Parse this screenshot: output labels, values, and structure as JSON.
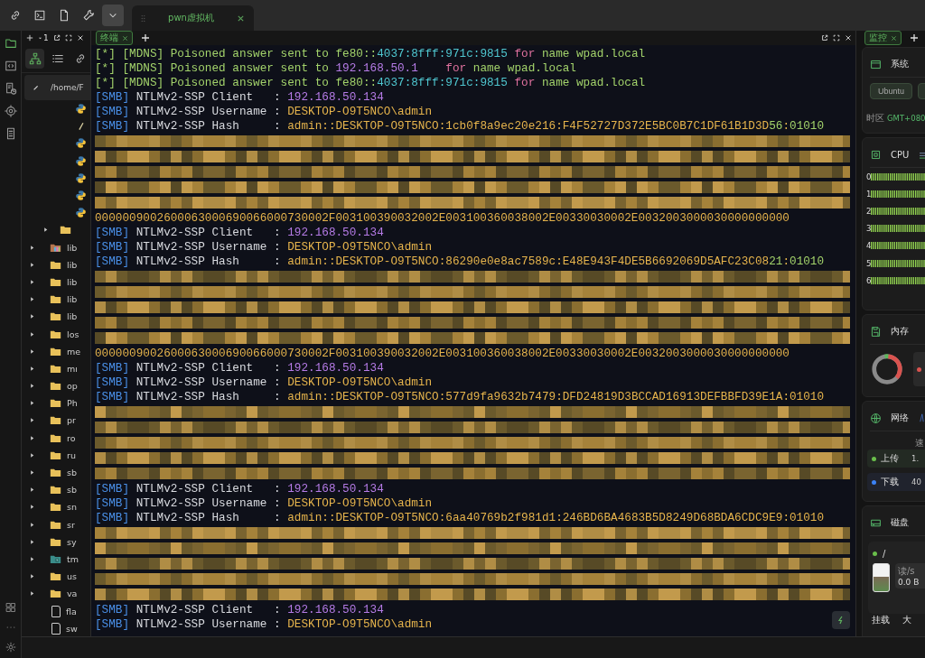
{
  "top_bar": {
    "tools": [
      {
        "kind": "link",
        "selected": false
      },
      {
        "kind": "terminal",
        "selected": false
      },
      {
        "kind": "document",
        "selected": false
      },
      {
        "kind": "wrench",
        "selected": false
      },
      {
        "kind": "chevron",
        "selected": true
      }
    ],
    "tabs": [
      {
        "title": "pwn虚拟机",
        "selected": true
      }
    ]
  },
  "activity_bar": {
    "items": [
      {
        "kind": "folder",
        "selected": true
      },
      {
        "kind": "code",
        "selected": false
      },
      {
        "kind": "database",
        "selected": false
      },
      {
        "kind": "target",
        "selected": false
      },
      {
        "kind": "list",
        "selected": false
      }
    ],
    "bottom": [
      {
        "kind": "grid"
      },
      {
        "kind": "more"
      },
      {
        "kind": "gear"
      }
    ]
  },
  "file_panel": {
    "count": "1",
    "views": [
      {
        "kind": "tree",
        "selected": true
      },
      {
        "kind": "list",
        "selected": false
      },
      {
        "kind": "link",
        "selected": false
      }
    ],
    "path": "/home/F",
    "nested_files": [
      {
        "kind": "python"
      },
      {
        "kind": "pen"
      },
      {
        "kind": "python"
      },
      {
        "kind": "python"
      },
      {
        "kind": "python"
      },
      {
        "kind": "python"
      },
      {
        "kind": "python"
      }
    ],
    "nested_folders": [
      {
        "kind": "folder"
      }
    ],
    "entries": [
      {
        "name": "lib",
        "kind": "colorful"
      },
      {
        "name": "lib",
        "kind": "folder"
      },
      {
        "name": "lib",
        "kind": "folder"
      },
      {
        "name": "lib",
        "kind": "folder"
      },
      {
        "name": "lib",
        "kind": "folder"
      },
      {
        "name": "los",
        "kind": "folder"
      },
      {
        "name": "me",
        "kind": "folder"
      },
      {
        "name": "mı",
        "kind": "folder"
      },
      {
        "name": "op",
        "kind": "folder"
      },
      {
        "name": "Ph",
        "kind": "folder"
      },
      {
        "name": "pr",
        "kind": "folder"
      },
      {
        "name": "ro",
        "kind": "folder"
      },
      {
        "name": "ru",
        "kind": "folder"
      },
      {
        "name": "sb",
        "kind": "folder"
      },
      {
        "name": "sb",
        "kind": "folder"
      },
      {
        "name": "sn",
        "kind": "folder"
      },
      {
        "name": "sr",
        "kind": "folder"
      },
      {
        "name": "sy",
        "kind": "folder"
      },
      {
        "name": "tm",
        "kind": "clock"
      },
      {
        "name": "us",
        "kind": "folder"
      },
      {
        "name": "va",
        "kind": "folder"
      },
      {
        "name": "fla",
        "kind": "file"
      },
      {
        "name": "sw",
        "kind": "file"
      }
    ]
  },
  "terminal": {
    "tabs": [
      {
        "title": "终端",
        "selected": true
      }
    ],
    "blocks": [
      {
        "kind": "line",
        "segments": [
          {
            "text": "[*] [MDNS] Poisoned answer sent to fe80::",
            "color": "#a3d36b"
          },
          {
            "text": "4037:8fff:971c:9815",
            "color": "#4fc6cf"
          },
          {
            "text": " for",
            "color": "#e0719f"
          },
          {
            "text": " name wpad.local",
            "color": "#a3d36b"
          }
        ]
      },
      {
        "kind": "line",
        "segments": [
          {
            "text": "[*] [MDNS] Poisoned answer sent to ",
            "color": "#a3d36b"
          },
          {
            "text": "192.168.50.1",
            "color": "#b57be6"
          },
          {
            "text": "    for",
            "color": "#e0719f"
          },
          {
            "text": " name wpad.local",
            "color": "#a3d36b"
          }
        ]
      },
      {
        "kind": "line",
        "segments": [
          {
            "text": "[*] [MDNS] Poisoned answer sent to fe80::",
            "color": "#a3d36b"
          },
          {
            "text": "4037:8fff:971c:9815",
            "color": "#4fc6cf"
          },
          {
            "text": " for",
            "color": "#e0719f"
          },
          {
            "text": " name wpad.local",
            "color": "#a3d36b"
          }
        ]
      },
      {
        "kind": "line",
        "segments": [
          {
            "text": "[SMB]",
            "color": "#4a90e8"
          },
          {
            "text": " NTLMv2-SSP Client   : ",
            "color": "#d9dbe0"
          },
          {
            "text": "192.168.50.134",
            "color": "#b57be6"
          }
        ]
      },
      {
        "kind": "line",
        "segments": [
          {
            "text": "[SMB]",
            "color": "#4a90e8"
          },
          {
            "text": " NTLMv2-SSP Username : ",
            "color": "#d9dbe0"
          },
          {
            "text": "DESKTOP-O9T5NCO\\admin",
            "color": "#e6b44c"
          }
        ]
      },
      {
        "kind": "line",
        "segments": [
          {
            "text": "[SMB]",
            "color": "#4a90e8"
          },
          {
            "text": " NTLMv2-SSP Hash     : ",
            "color": "#d9dbe0"
          },
          {
            "text": "admin::DESKTOP-O9T5NCO:1cb0f8a9ec20e216:F4F52727D372E5BC0B7C1DF61B1D3D",
            "color": "#e6b44c"
          },
          {
            "text": "56",
            "color": "#a3d36b"
          },
          {
            "text": ":",
            "color": "#e6b44c"
          },
          {
            "text": "01010",
            "color": "#a3d36b"
          }
        ]
      },
      {
        "kind": "redacted"
      },
      {
        "kind": "line",
        "segments": [
          {
            "text": "0000009002600063000690066000730002F003100390032002E003100360038002E00330030002E0032003000030000000000",
            "color": "#e6b44c"
          }
        ]
      },
      {
        "kind": "line",
        "segments": [
          {
            "text": "[SMB]",
            "color": "#4a90e8"
          },
          {
            "text": " NTLMv2-SSP Client   : ",
            "color": "#d9dbe0"
          },
          {
            "text": "192.168.50.134",
            "color": "#b57be6"
          }
        ]
      },
      {
        "kind": "line",
        "segments": [
          {
            "text": "[SMB]",
            "color": "#4a90e8"
          },
          {
            "text": " NTLMv2-SSP Username : ",
            "color": "#d9dbe0"
          },
          {
            "text": "DESKTOP-O9T5NCO\\admin",
            "color": "#e6b44c"
          }
        ]
      },
      {
        "kind": "line",
        "segments": [
          {
            "text": "[SMB]",
            "color": "#4a90e8"
          },
          {
            "text": " NTLMv2-SSP Hash     : ",
            "color": "#d9dbe0"
          },
          {
            "text": "admin::DESKTOP-O9T5NCO:86290e0e8ac7589c:E48E943F4DE5B6692069D5AFC23C08",
            "color": "#e6b44c"
          },
          {
            "text": "21",
            "color": "#a3d36b"
          },
          {
            "text": ":",
            "color": "#e6b44c"
          },
          {
            "text": "01010",
            "color": "#a3d36b"
          }
        ]
      },
      {
        "kind": "redacted"
      },
      {
        "kind": "line",
        "segments": [
          {
            "text": "0000009002600063000690066000730002F003100390032002E003100360038002E00330030002E0032003000030000000000",
            "color": "#e6b44c"
          }
        ]
      },
      {
        "kind": "line",
        "segments": [
          {
            "text": "[SMB]",
            "color": "#4a90e8"
          },
          {
            "text": " NTLMv2-SSP Client   : ",
            "color": "#d9dbe0"
          },
          {
            "text": "192.168.50.134",
            "color": "#b57be6"
          }
        ]
      },
      {
        "kind": "line",
        "segments": [
          {
            "text": "[SMB]",
            "color": "#4a90e8"
          },
          {
            "text": " NTLMv2-SSP Username : ",
            "color": "#d9dbe0"
          },
          {
            "text": "DESKTOP-O9T5NCO\\admin",
            "color": "#e6b44c"
          }
        ]
      },
      {
        "kind": "line",
        "segments": [
          {
            "text": "[SMB]",
            "color": "#4a90e8"
          },
          {
            "text": " NTLMv2-SSP Hash     : ",
            "color": "#d9dbe0"
          },
          {
            "text": "admin::DESKTOP-O9T5NCO:577d9fa9632b7479:DFD24819D3BCCAD16913DEFBBFD39E1A:01010",
            "color": "#e6b44c"
          }
        ]
      },
      {
        "kind": "redacted"
      },
      {
        "kind": "line",
        "segments": [
          {
            "text": "[SMB]",
            "color": "#4a90e8"
          },
          {
            "text": " NTLMv2-SSP Client   : ",
            "color": "#d9dbe0"
          },
          {
            "text": "192.168.50.134",
            "color": "#b57be6"
          }
        ]
      },
      {
        "kind": "line",
        "segments": [
          {
            "text": "[SMB]",
            "color": "#4a90e8"
          },
          {
            "text": " NTLMv2-SSP Username : ",
            "color": "#d9dbe0"
          },
          {
            "text": "DESKTOP-O9T5NCO\\admin",
            "color": "#e6b44c"
          }
        ]
      },
      {
        "kind": "line",
        "segments": [
          {
            "text": "[SMB]",
            "color": "#4a90e8"
          },
          {
            "text": " NTLMv2-SSP Hash     : ",
            "color": "#d9dbe0"
          },
          {
            "text": "admin::DESKTOP-O9T5NCO:6aa40769b2f981d1:246BD6BA4683B5D8249D68BDA6CDC9E9:01010",
            "color": "#e6b44c"
          }
        ]
      },
      {
        "kind": "redacted"
      },
      {
        "kind": "line",
        "segments": [
          {
            "text": "[SMB]",
            "color": "#4a90e8"
          },
          {
            "text": " NTLMv2-SSP Client   : ",
            "color": "#d9dbe0"
          },
          {
            "text": "192.168.50.134",
            "color": "#b57be6"
          }
        ]
      },
      {
        "kind": "line",
        "segments": [
          {
            "text": "[SMB]",
            "color": "#4a90e8"
          },
          {
            "text": " NTLMv2-SSP Username : ",
            "color": "#d9dbe0"
          },
          {
            "text": "DESKTOP-O9T5NCO\\admin",
            "color": "#e6b44c"
          }
        ]
      }
    ]
  },
  "monitor": {
    "tabs": [
      {
        "title": "监控",
        "selected": true
      }
    ],
    "system": {
      "title": "系统",
      "os_button": "Ubuntu",
      "timezone_label": "时区",
      "timezone": "GMT+080"
    },
    "cpu": {
      "title": "CPU",
      "cores": [
        "0",
        "1",
        "2",
        "3",
        "4",
        "5",
        "6"
      ]
    },
    "memory": {
      "title": "内存"
    },
    "network": {
      "title": "网络",
      "column_head": "速",
      "rows": [
        {
          "label": "上传",
          "value": "1.",
          "color": "#6abf4b"
        },
        {
          "label": "下载",
          "value": "40",
          "color": "#3b82f6"
        }
      ]
    },
    "disk": {
      "title": "磁盘",
      "mount": "/",
      "level": 0.55,
      "read_label": "读/s",
      "read_value": "0.0 B",
      "table_heads": [
        "挂载",
        "大"
      ]
    }
  }
}
